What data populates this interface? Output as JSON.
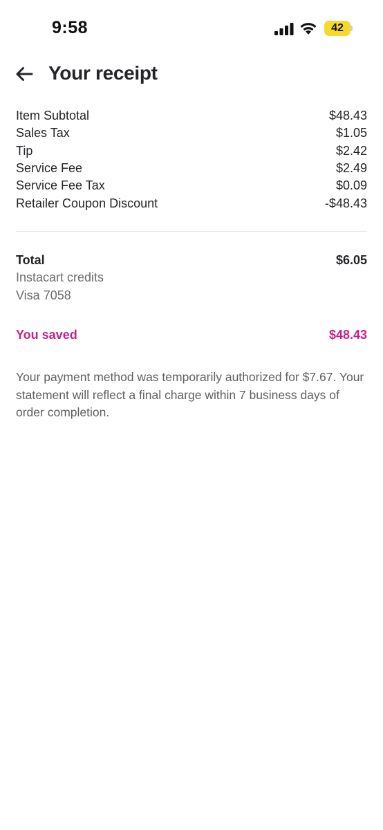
{
  "status_bar": {
    "time": "9:58",
    "battery_level": "42",
    "icons": [
      "signal-icon",
      "wifi-icon",
      "battery-icon"
    ]
  },
  "header": {
    "title": "Your receipt",
    "back_icon": "arrow-left-icon"
  },
  "fees": [
    {
      "label": "Item Subtotal",
      "amount": "$48.43"
    },
    {
      "label": "Sales Tax",
      "amount": "$1.05"
    },
    {
      "label": "Tip",
      "amount": "$2.42"
    },
    {
      "label": "Service Fee",
      "amount": "$2.49"
    },
    {
      "label": "Service Fee Tax",
      "amount": "$0.09"
    },
    {
      "label": "Retailer Coupon Discount",
      "amount": "-$48.43"
    }
  ],
  "total": {
    "label": "Total",
    "amount": "$6.05",
    "payment_lines": [
      "Instacart credits",
      "Visa 7058"
    ]
  },
  "savings": {
    "label": "You saved",
    "amount": "$48.43"
  },
  "note": "Your payment method was temporarily authorized for $7.67. Your statement will reflect a final charge within 7 business days of order completion.",
  "colors": {
    "accent_savings": "#c6218b",
    "battery": "#f6d92a",
    "text_primary": "#242529",
    "text_muted": "#6c6d70"
  }
}
